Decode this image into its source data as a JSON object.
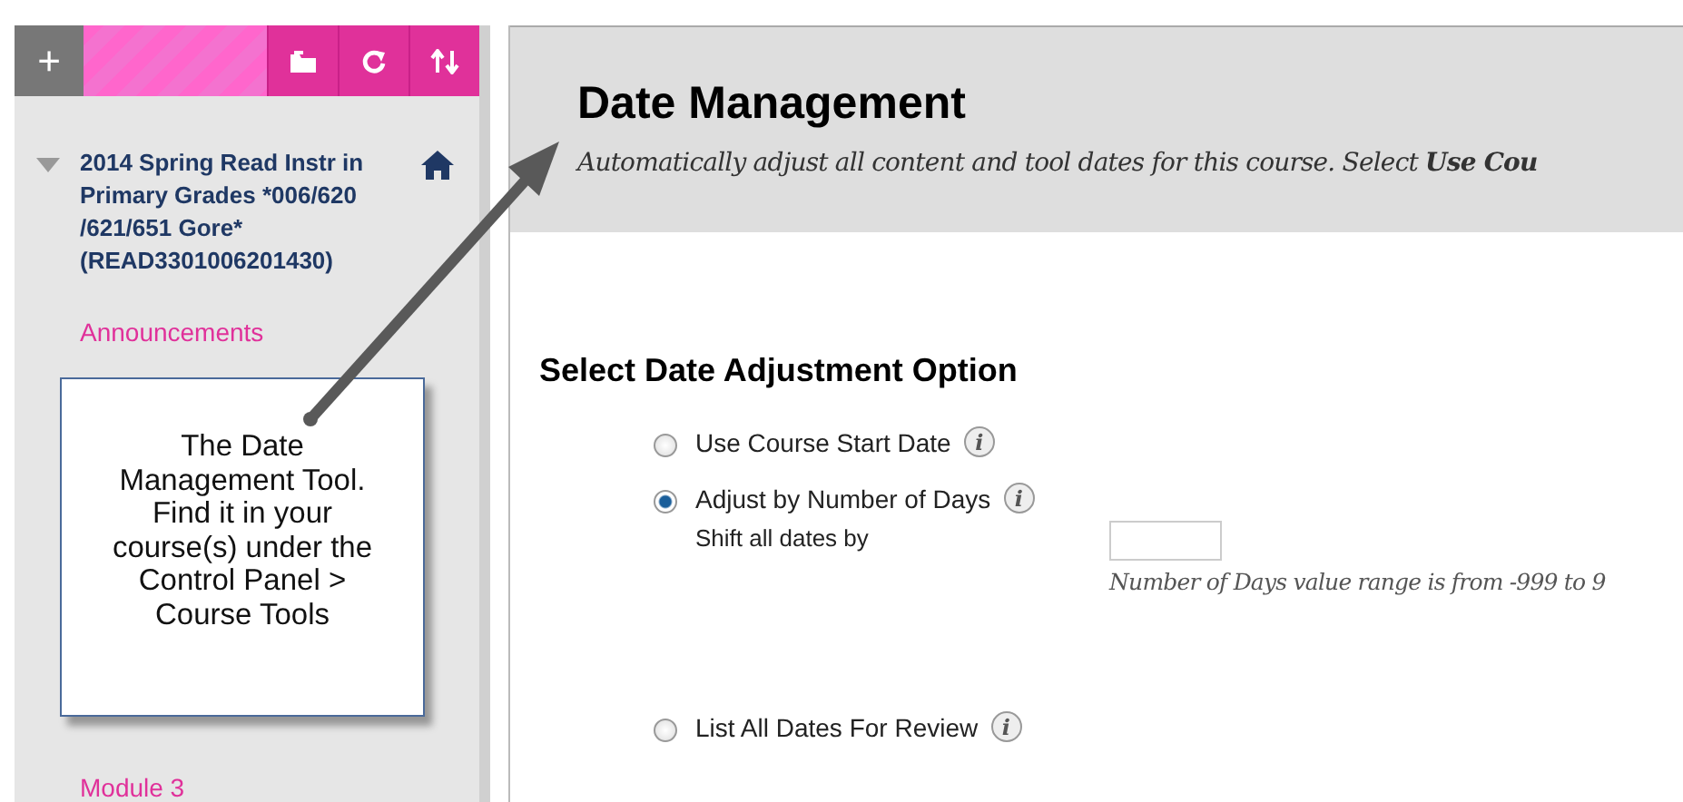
{
  "sidebar": {
    "toolbar": {
      "add": "+"
    },
    "course": {
      "title": "2014 Spring Read Instr in Primary Grades *006/620 /621/651 Gore* (READ3301006201430)",
      "expanded": true
    },
    "links": [
      "Announcements",
      "Module 3"
    ]
  },
  "callout": {
    "text": "The Date Management Tool. Find it in your course(s) under the Control Panel > Course Tools"
  },
  "page": {
    "title": "Date Management",
    "description": "Automatically adjust all content and tool dates for this course. Select **Use Cou**",
    "section": "Select Date Adjustment Option",
    "options": [
      {
        "label": "Use Course Start Date",
        "selected": false,
        "info": "i"
      },
      {
        "label": "Adjust by Number of Days",
        "selected": true,
        "info": "i",
        "field_label": "Shift all dates by",
        "hint": "Number of Days value range is from -999 to 9"
      },
      {
        "label": "List All Dates For Review",
        "selected": false,
        "info": "i"
      }
    ]
  }
}
